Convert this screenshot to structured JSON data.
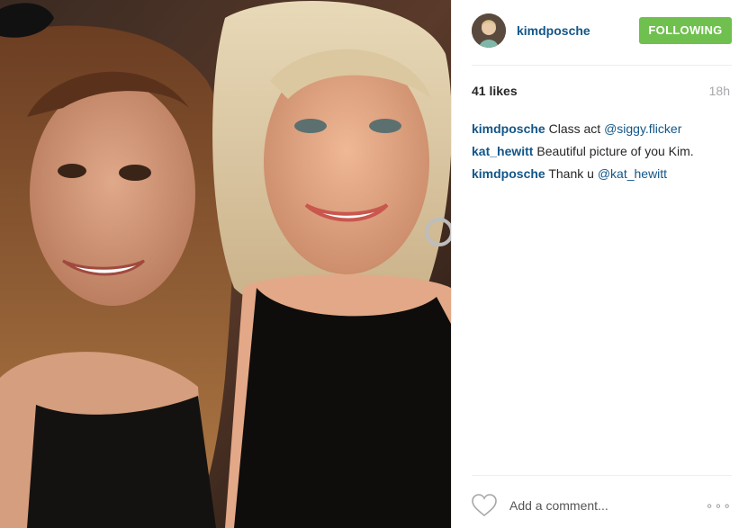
{
  "post": {
    "username": "kimdposche",
    "follow_label": "FOLLOWING",
    "likes": "41 likes",
    "time": "18h"
  },
  "comments": [
    {
      "user": "kimdposche",
      "text": "Class act ",
      "mention": "@siggy.flicker"
    },
    {
      "user": "kat_hewitt",
      "text": "Beautiful picture of you Kim.",
      "mention": ""
    },
    {
      "user": "kimdposche",
      "text": "Thank u ",
      "mention": "@kat_hewitt"
    }
  ],
  "footer": {
    "add_comment_placeholder": "Add a comment...",
    "more_label": "∘∘∘"
  },
  "icons": {
    "like": "heart-icon",
    "more": "more-options-icon"
  },
  "colors": {
    "link": "#125688",
    "follow_button": "#70c050",
    "muted": "#a5a7aa"
  }
}
